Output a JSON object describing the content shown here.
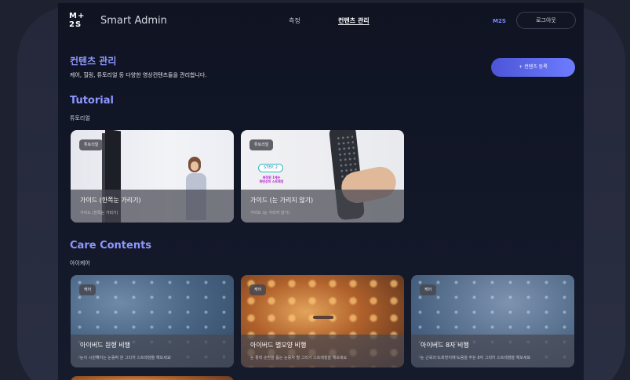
{
  "header": {
    "logo": "M+\n2S",
    "brand": "Smart Admin",
    "nav": [
      {
        "label": "측정",
        "active": false
      },
      {
        "label": "컨텐츠 관리",
        "active": true
      }
    ],
    "user": "M2S",
    "logout": "로그아웃"
  },
  "page": {
    "title": "컨텐츠 관리",
    "description": "케어, 힐링, 튜토리얼 등 다양한 영상컨텐츠들을 관리합니다.",
    "add_button": "+ 컨텐츠 등록"
  },
  "sections": [
    {
      "title": "Tutorial",
      "subtitle": "튜토리얼",
      "cards": [
        {
          "badge": "튜토리얼",
          "title": "가이드 (한쪽눈 가리기)",
          "subtitle": "가이드 (한쪽눈 가리기)"
        },
        {
          "badge": "튜토리얼",
          "title": "가이드 (눈 가리지 않기)",
          "subtitle": "가이드 (눈 가리지 않기)",
          "overlay_step": "STEP. 2",
          "overlay_text": "측정된 1에는\n화면상의 스트레칭"
        }
      ]
    },
    {
      "title": "Care Contents",
      "subtitle": "아이케어",
      "cards": [
        {
          "badge": "케어",
          "title": "아이버드 원형 비행",
          "subtitle": "눈이 시원해지는 눈동자 원 그리기 스트레칭을 해보세요"
        },
        {
          "badge": "케어",
          "title": "아이버드 별모양 비행",
          "subtitle": "눈 활력 순환을 돕는 눈동자 별 그리기 스트레칭을 해보세요"
        },
        {
          "badge": "케어",
          "title": "아이버드 8자 비행",
          "subtitle": "눈 근육의 노화방지에 도움을 주는 8자 그리기 스트레칭을 해보세요"
        }
      ]
    }
  ]
}
